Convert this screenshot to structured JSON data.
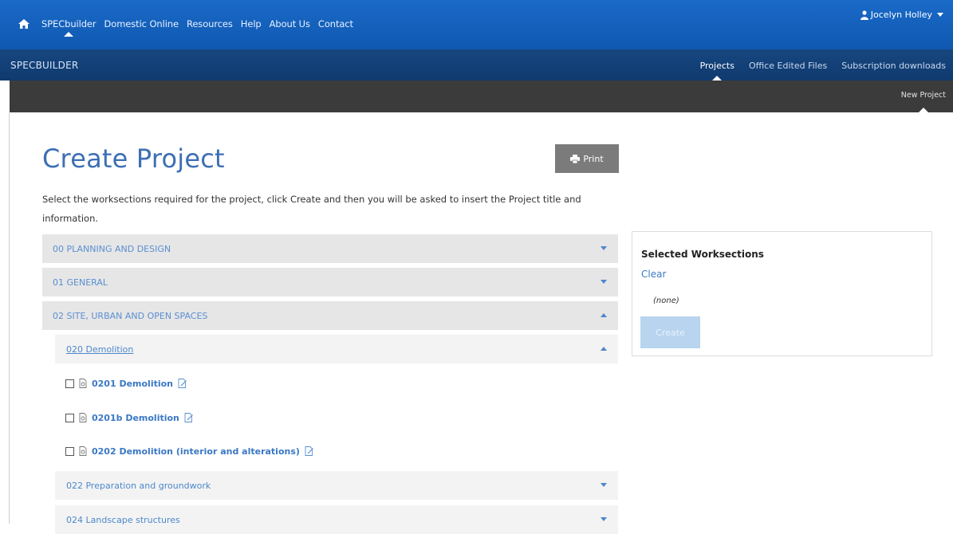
{
  "topnav": {
    "items": [
      "SPECbuilder",
      "Domestic Online",
      "Resources",
      "Help",
      "About Us",
      "Contact"
    ],
    "user": "Jocelyn Holley"
  },
  "subbar": {
    "brand": "SPECBUILDER",
    "items": [
      "Projects",
      "Office Edited Files",
      "Subscription downloads"
    ]
  },
  "darkbar": {
    "new_project": "New Project"
  },
  "page": {
    "title": "Create Project",
    "print_label": "Print",
    "intro": "Select the worksections required for the project, click Create and then you will be asked to insert the Project title and information."
  },
  "sections": [
    {
      "label": "00 PLANNING AND DESIGN"
    },
    {
      "label": "01 GENERAL"
    },
    {
      "label": "02 SITE, URBAN AND OPEN SPACES"
    }
  ],
  "subsections": [
    {
      "label": "020 Demolition"
    },
    {
      "label": "022 Preparation and groundwork"
    },
    {
      "label": "024 Landscape structures"
    }
  ],
  "worksections": [
    {
      "label": "0201 Demolition"
    },
    {
      "label": "0201b Demolition"
    },
    {
      "label": "0202 Demolition (interior and alterations)"
    }
  ],
  "panel": {
    "title": "Selected Worksections",
    "clear": "Clear",
    "none": "(none)",
    "create": "Create"
  }
}
